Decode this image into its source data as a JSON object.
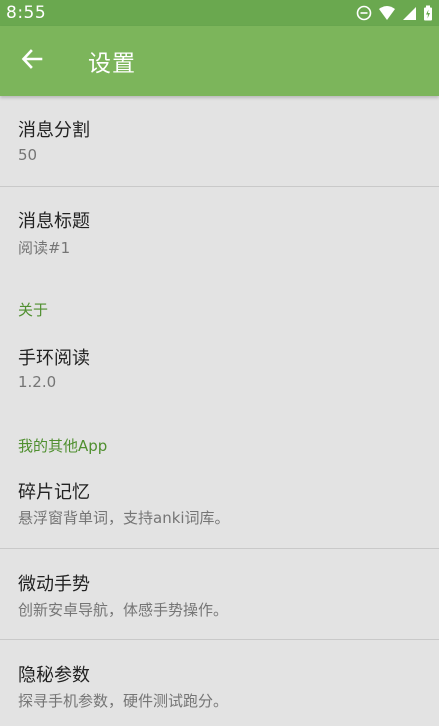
{
  "status_bar": {
    "time": "8:55",
    "icons": [
      "do-not-disturb-icon",
      "wifi-icon",
      "signal-icon",
      "battery-icon"
    ]
  },
  "app_bar": {
    "title": "设置",
    "back_icon": "arrow-back-icon"
  },
  "items": {
    "split": {
      "title": "消息分割",
      "summary": "50"
    },
    "msg_title": {
      "title": "消息标题",
      "summary": "阅读#1"
    },
    "about_header": "关于",
    "app": {
      "title": "手环阅读",
      "summary": "1.2.0"
    },
    "other_apps_header": "我的其他App",
    "fragment": {
      "title": "碎片记忆",
      "summary": "悬浮窗背单词，支持anki词库。"
    },
    "gesture": {
      "title": "微动手势",
      "summary": "创新安卓导航，体感手势操作。"
    },
    "params": {
      "title": "隐秘参数",
      "summary": "探寻手机参数，硬件测试跑分。"
    }
  },
  "colors": {
    "status_bar": "#6aa84f",
    "app_bar": "#7cb55b",
    "background": "#e3e3e3",
    "category_text": "#4f8f2f"
  }
}
